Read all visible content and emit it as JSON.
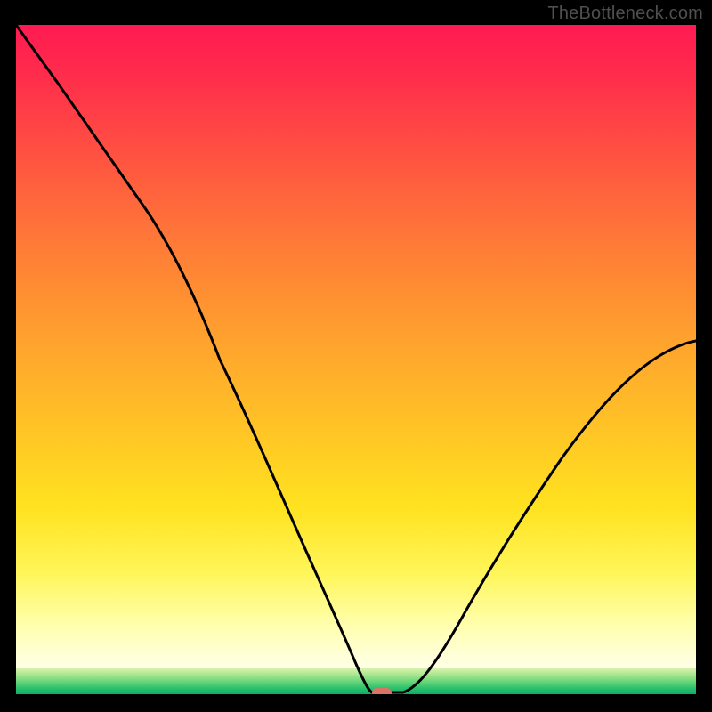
{
  "watermark": "TheBottleneck.com",
  "chart_data": {
    "type": "line",
    "title": "",
    "xlabel": "",
    "ylabel": "",
    "x": [
      0,
      3,
      6,
      9,
      12,
      15,
      18,
      21,
      24,
      27,
      30,
      33,
      36,
      39,
      42,
      45,
      48,
      50,
      52,
      55,
      58,
      61,
      65,
      70,
      75,
      80,
      85,
      90,
      95,
      100
    ],
    "y": [
      100,
      94,
      88,
      82,
      76,
      71,
      67,
      62,
      56,
      50,
      44,
      38,
      32,
      26,
      20,
      14,
      8,
      3,
      0,
      0,
      0,
      4,
      10,
      17,
      24,
      30,
      36,
      42,
      47,
      52
    ],
    "xlim": [
      0,
      100
    ],
    "ylim": [
      0,
      100
    ],
    "marker": {
      "x": 53,
      "y": 0
    },
    "green_band": {
      "y_start": 96,
      "y_end": 100,
      "colors_top_to_bottom": [
        "#cef0a0",
        "#9ee086",
        "#58cf77",
        "#1fc06c",
        "#0cae64"
      ]
    },
    "colors": {
      "gradient_top": "#ff1a52",
      "gradient_bottom": "#ffffe8",
      "curve": "#000000",
      "marker": "#d87366",
      "background": "#000000",
      "watermark": "#4f4f4f"
    }
  }
}
